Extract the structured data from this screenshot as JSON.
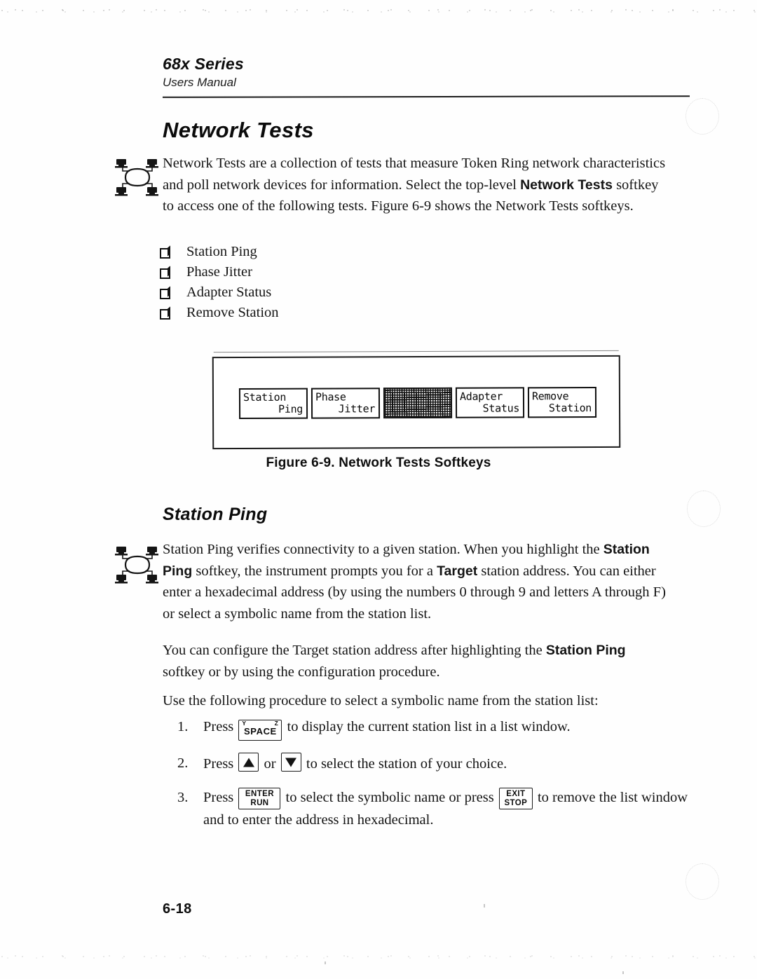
{
  "header": {
    "title": "68x Series",
    "subtitle": "Users Manual"
  },
  "chapter": {
    "heading": "Network Tests",
    "intro_1": "Network Tests are a collection of tests that measure Token Ring network characteristics and poll network devices for information.  Select the top-level ",
    "intro_bold": "Network Tests",
    "intro_2": " softkey to access one of the following tests.  Figure 6-9 shows the Network Tests softkeys.",
    "bullets": [
      "Station Ping",
      "Phase Jitter",
      "Adapter Status",
      "Remove Station"
    ]
  },
  "figure": {
    "caption": "Figure 6-9.  Network Tests Softkeys",
    "softkeys": [
      {
        "line1": "Station",
        "line2": "Ping",
        "filled": false
      },
      {
        "line1": "Phase",
        "line2": "Jitter",
        "filled": false
      },
      {
        "line1": "",
        "line2": "",
        "filled": true
      },
      {
        "line1": "Adapter",
        "line2": "Status",
        "filled": false
      },
      {
        "line1": "Remove",
        "line2": "Station",
        "filled": false
      }
    ]
  },
  "section": {
    "heading": "Station Ping",
    "para1_a": "Station Ping verifies connectivity to a given station.  When you highlight the ",
    "para1_b1": "Station Ping",
    "para1_b": " softkey, the instrument prompts you for a ",
    "para1_b2": "Target",
    "para1_c": " station address.  You can either enter a hexadecimal address (by using the numbers 0 through 9 and letters A through F) or select a symbolic name from the station list.",
    "para2_a": "You can configure the Target station address after highlighting the ",
    "para2_b": "Station Ping",
    "para2_c": " softkey or by using the configuration procedure.",
    "para3": "Use the following procedure to select a symbolic name from the station list:"
  },
  "procedure": [
    {
      "num": "1.",
      "text_a": "Press ",
      "key": {
        "type": "space",
        "label": "SPACE",
        "shoulder_left": "Y",
        "shoulder_right": "Z"
      },
      "text_b": " to display the current station list in a list window."
    },
    {
      "num": "2.",
      "text_a": "Press ",
      "key": {
        "type": "arrow-up"
      },
      "text_mid": " or ",
      "key2": {
        "type": "arrow-down"
      },
      "text_b": " to select the station of your choice."
    },
    {
      "num": "3.",
      "text_a": "Press ",
      "key": {
        "type": "two-line",
        "line1": "ENTER",
        "line2": "RUN"
      },
      "text_mid": " to select the symbolic name or press ",
      "key2": {
        "type": "two-line",
        "line1": "EXIT",
        "line2": "STOP"
      },
      "text_b": " to remove the list window and to enter the address in hexadecimal."
    }
  ],
  "footer": {
    "page_number": "6-18"
  },
  "icons": {
    "margin_graphic": "token-ring-network-icon",
    "bullet": "square-bullet-icon"
  },
  "colors": {
    "ink": "#131313",
    "paper": "#ffffff",
    "rule": "#1a1a1a"
  }
}
